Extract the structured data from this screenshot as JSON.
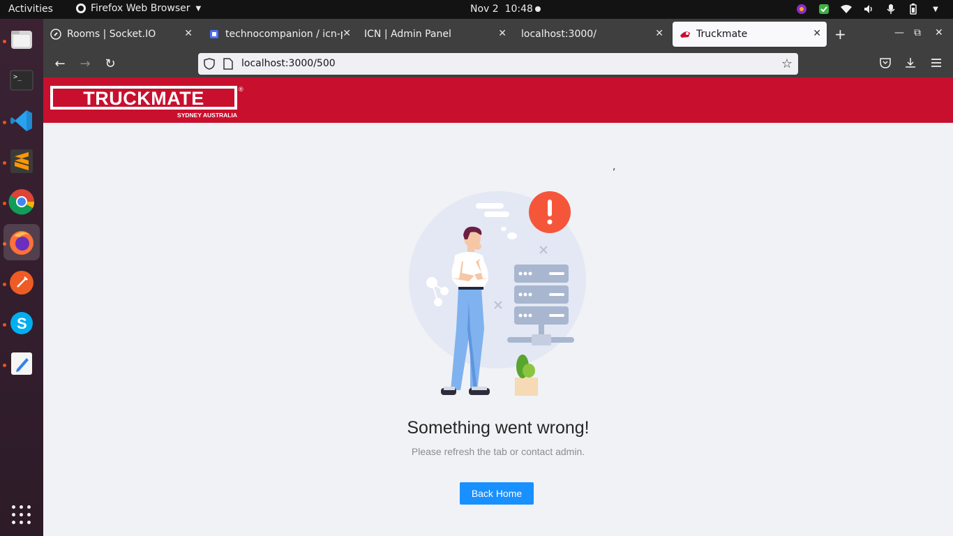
{
  "system": {
    "activities": "Activities",
    "app_name": "Firefox Web Browser",
    "date": "Nov 2",
    "time": "10:48"
  },
  "dock": {
    "items": [
      "files-icon",
      "terminal-icon",
      "vscode-icon",
      "sublime-icon",
      "chrome-icon",
      "firefox-icon",
      "postman-icon",
      "skype-icon",
      "text-editor-icon"
    ],
    "active": "firefox-icon"
  },
  "browser": {
    "tabs": [
      {
        "label": "Rooms | Socket.IO",
        "active": false
      },
      {
        "label": "technocompanion / icn-pl",
        "active": false
      },
      {
        "label": "ICN | Admin Panel",
        "active": false
      },
      {
        "label": "localhost:3000/",
        "active": false
      },
      {
        "label": "Truckmate",
        "active": true
      }
    ],
    "url": "localhost:3000/500"
  },
  "site": {
    "logo_text": "TRUCKMATE",
    "logo_sub": "SYDNEY AUSTRALIA",
    "logo_mark": "®",
    "brand_color": "#c8102e",
    "stray_char": ","
  },
  "error": {
    "title": "Something went wrong!",
    "subtitle": "Please refresh the tab or contact admin.",
    "button": "Back Home",
    "accent": "#1890ff",
    "alert_color": "#f5563a",
    "alert_glyph": "!"
  }
}
